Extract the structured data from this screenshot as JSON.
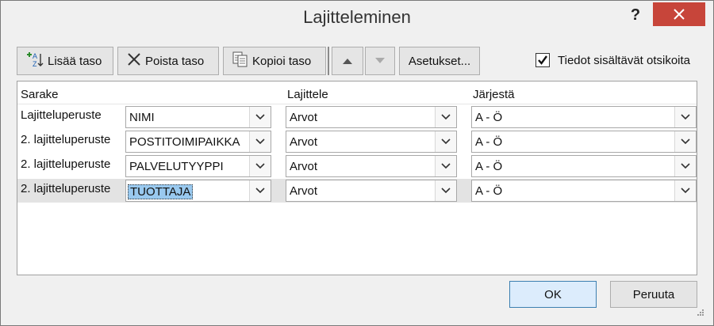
{
  "window": {
    "title": "Lajitteleminen",
    "help": "?"
  },
  "toolbar": {
    "add_level": "Lisää taso",
    "delete_level": "Poista taso",
    "copy_level": "Kopioi taso",
    "options": "Asetukset..."
  },
  "header_checkbox": {
    "label": "Tiedot sisältävät otsikoita",
    "checked": true
  },
  "grid": {
    "headers": {
      "column": "Sarake",
      "sort_on": "Lajittele",
      "order": "Järjestä"
    },
    "rows": [
      {
        "label": "Lajitteluperuste",
        "column": "NIMI",
        "sort_on": "Arvot",
        "order": "A - Ö"
      },
      {
        "label": "2. lajitteluperuste",
        "column": "POSTITOIMIPAIKKA",
        "sort_on": "Arvot",
        "order": "A - Ö"
      },
      {
        "label": "2. lajitteluperuste",
        "column": "PALVELUTYYPPI",
        "sort_on": "Arvot",
        "order": "A - Ö"
      },
      {
        "label": "2. lajitteluperuste",
        "column": "TUOTTAJA",
        "sort_on": "Arvot",
        "order": "A - Ö"
      }
    ]
  },
  "footer": {
    "ok": "OK",
    "cancel": "Peruuta"
  },
  "colors": {
    "close_button": "#c7453a",
    "selection": "#99c9ef",
    "primary_border": "#3c7fb1"
  }
}
